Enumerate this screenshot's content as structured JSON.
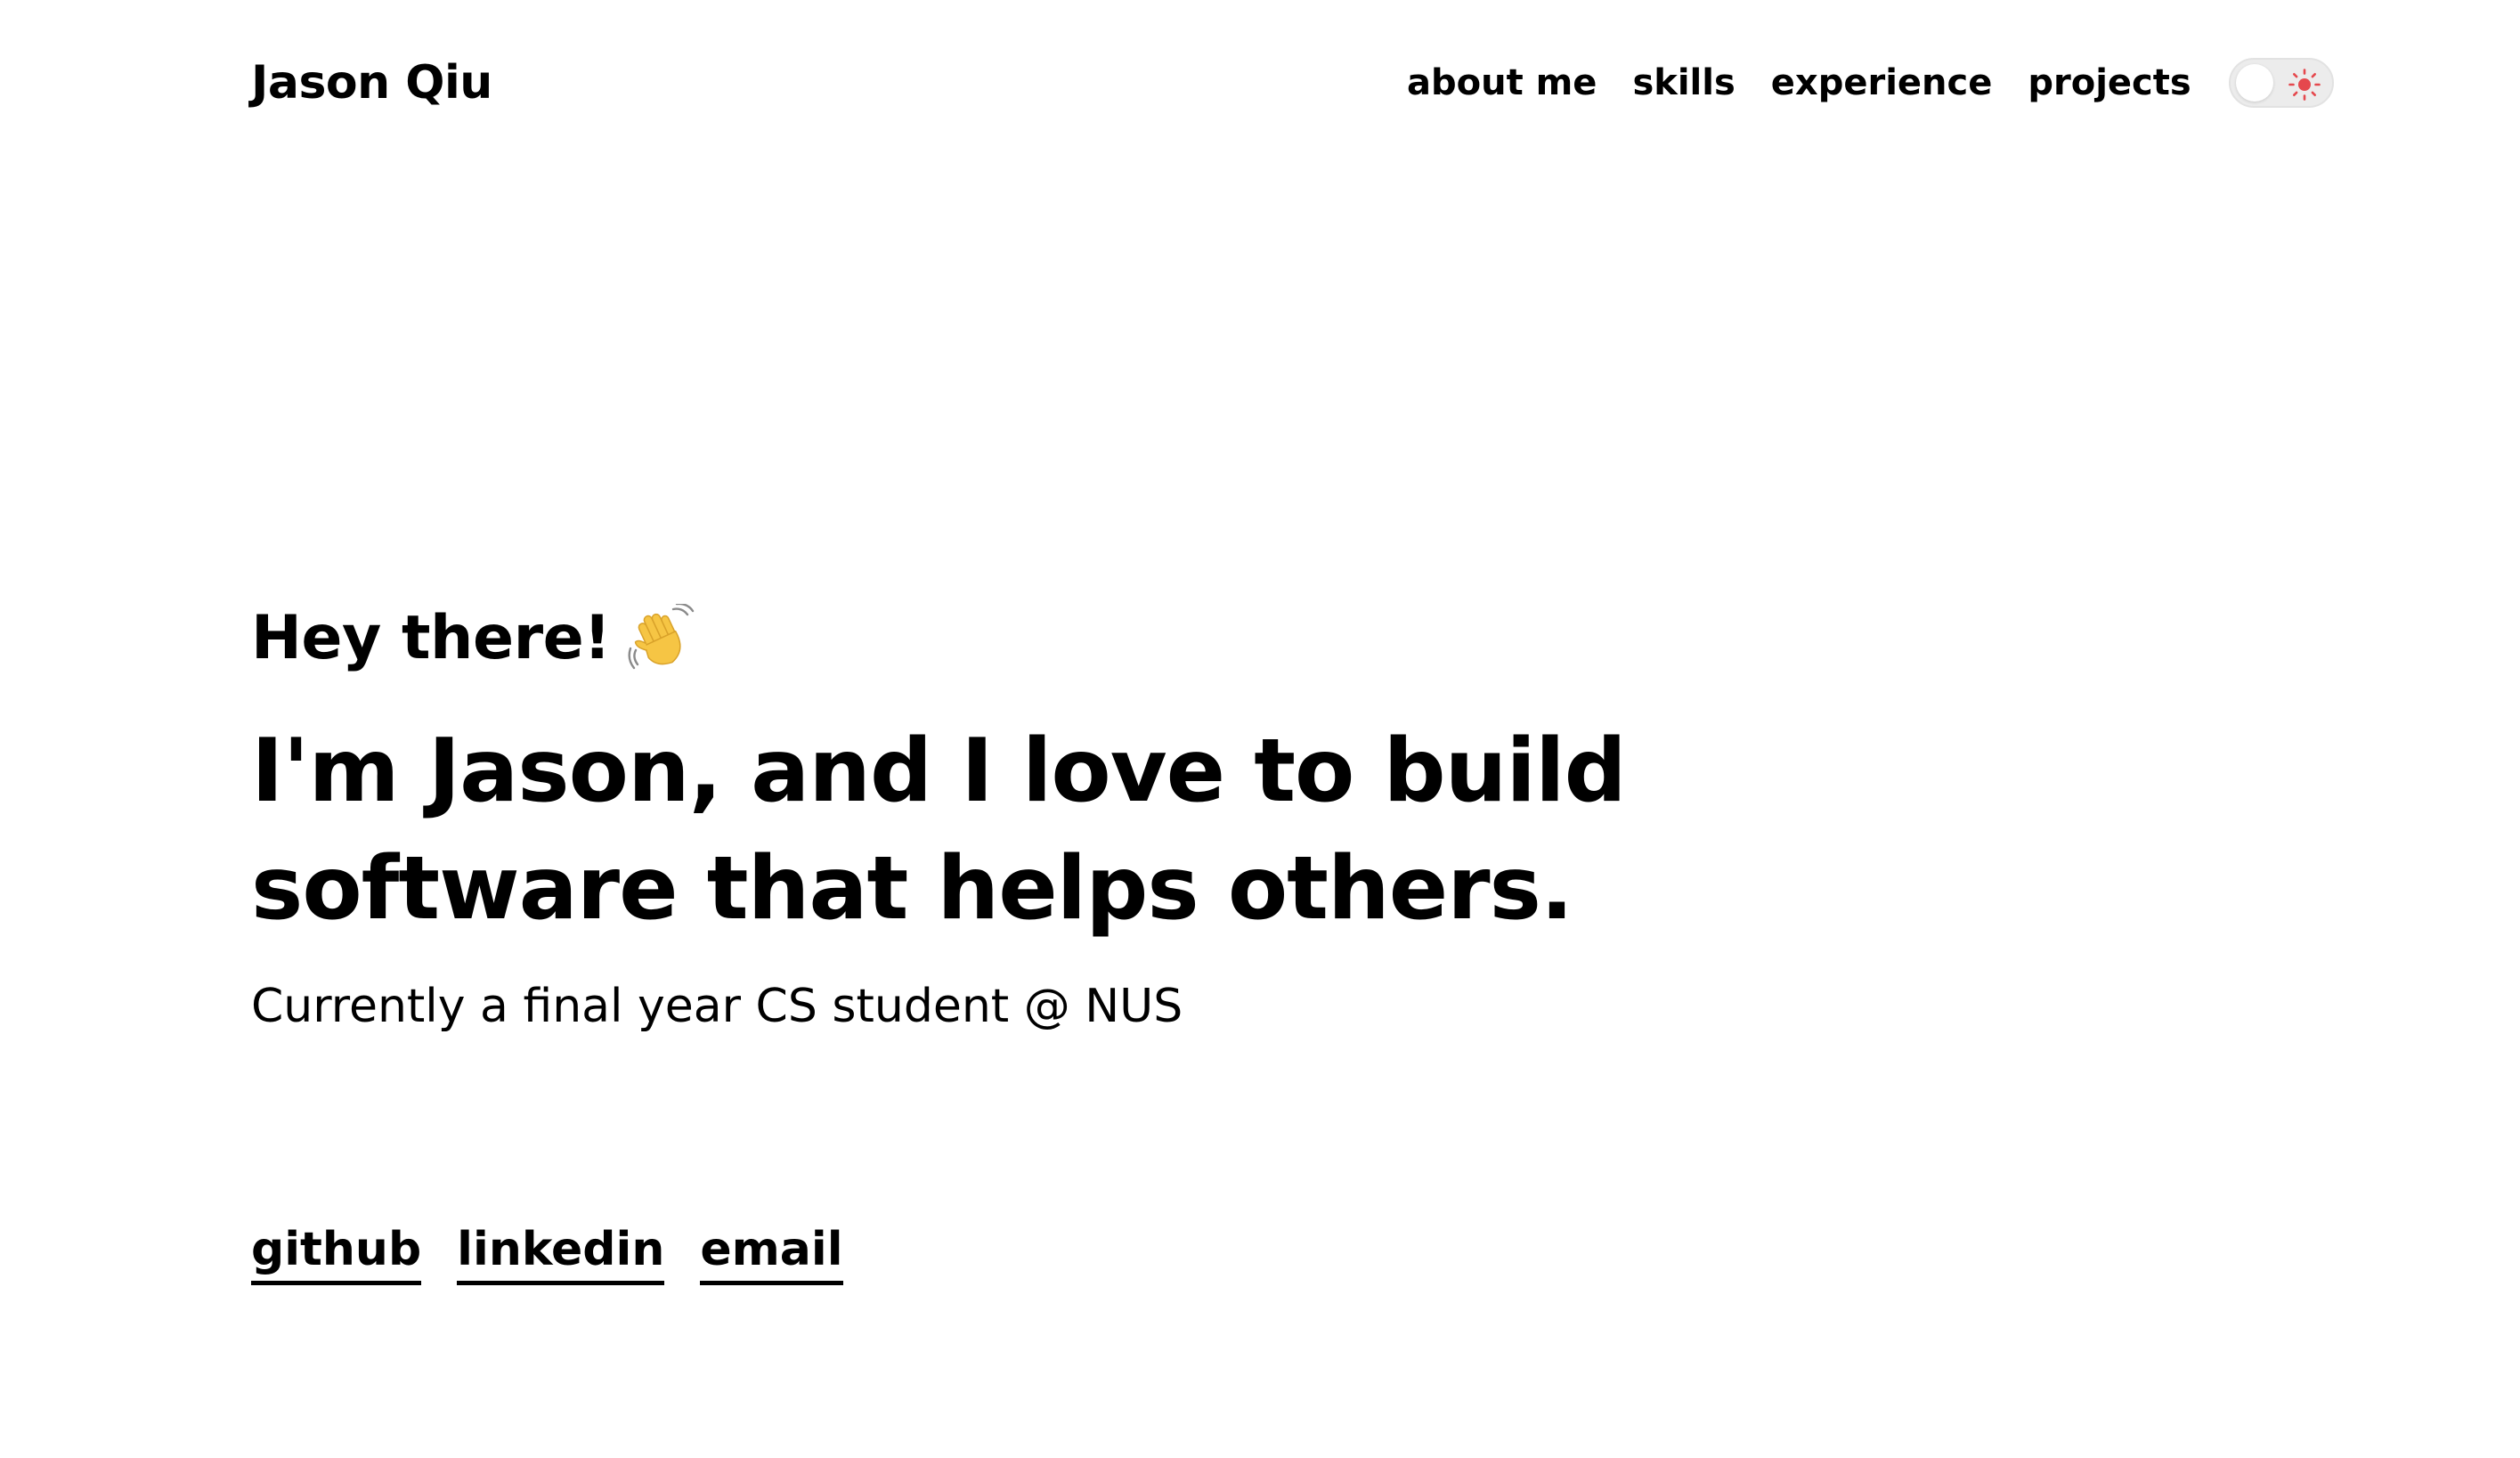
{
  "header": {
    "brand": "Jason Qiu",
    "nav": [
      "about me",
      "skills",
      "experience",
      "projects"
    ],
    "theme_toggle": {
      "icon": "sun-icon",
      "accent_color": "#e5484d",
      "state": "light"
    }
  },
  "hero": {
    "greeting": "Hey there!",
    "greeting_icon": "waving-hand-icon",
    "headline_line1": "I'm Jason, and I love to build",
    "headline_line2": "software that helps others.",
    "tagline": "Currently a final year CS student @ NUS"
  },
  "social": {
    "links": [
      "github",
      "linkedin",
      "email"
    ]
  }
}
